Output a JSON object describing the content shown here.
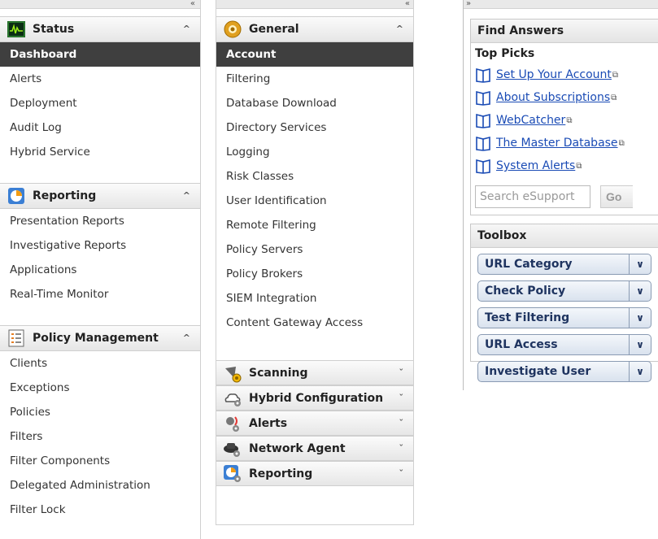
{
  "status_panel": {
    "collapse_glyph": "«",
    "sections": [
      {
        "title": "Status",
        "icon": "status-chart-icon",
        "items": [
          "Dashboard",
          "Alerts",
          "Deployment",
          "Audit Log",
          "Hybrid Service"
        ],
        "active": "Dashboard"
      },
      {
        "title": "Reporting",
        "icon": "reporting-pie-icon",
        "items": [
          "Presentation Reports",
          "Investigative Reports",
          "Applications",
          "Real-Time Monitor"
        ]
      },
      {
        "title": "Policy Management",
        "icon": "policy-list-icon",
        "items": [
          "Clients",
          "Exceptions",
          "Policies",
          "Filters",
          "Filter Components",
          "Delegated Administration",
          "Filter Lock"
        ]
      }
    ]
  },
  "settings_panel": {
    "collapse_glyph": "«",
    "general_title": "General",
    "items": [
      "Account",
      "Filtering",
      "Database Download",
      "Directory Services",
      "Logging",
      "Risk Classes",
      "User Identification",
      "Remote Filtering",
      "Policy Servers",
      "Policy Brokers",
      "SIEM Integration",
      "Content Gateway Access"
    ],
    "active": "Account",
    "collapsed_sections": [
      "Scanning",
      "Hybrid Configuration",
      "Alerts",
      "Network Agent",
      "Reporting"
    ]
  },
  "help_panel": {
    "expand_glyph": "»",
    "find_answers_title": "Find Answers",
    "top_picks_label": "Top Picks",
    "links": [
      "Set Up Your Account",
      "About Subscriptions",
      "WebCatcher",
      "The Master Database",
      "System Alerts"
    ],
    "search_placeholder": "Search eSupport",
    "go_label": "Go",
    "toolbox_title": "Toolbox",
    "tools": [
      "URL Category",
      "Check Policy",
      "Test Filtering",
      "URL Access",
      "Investigate User"
    ]
  },
  "colors": {
    "active_bg": "#3f3f3f",
    "link": "#1a4bb5",
    "tool_text": "#1f3460"
  }
}
